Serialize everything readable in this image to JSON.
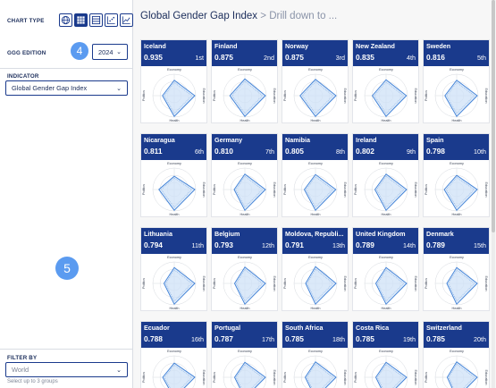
{
  "sidebar": {
    "chart_type_label": "CHART TYPE",
    "chart_type_options": [
      "globe-icon",
      "grid-icon",
      "list-icon",
      "scatter-icon",
      "line-icon"
    ],
    "edition_label": "GGG EDITION",
    "edition_badge": "4",
    "edition_value": "2024",
    "indicator_label": "INDICATOR",
    "indicator_value": "Global Gender Gap Index",
    "center_badge": "5",
    "filter_label": "FILTER BY",
    "filter_value": "World",
    "filter_hint": "Select up to 3 groups"
  },
  "main": {
    "title": "Global Gender Gap Index",
    "separator": ">",
    "drill_text": "Drill down to ...",
    "axis_labels": {
      "top": "Economy",
      "left": "Politics",
      "right": "Education",
      "bottom": "Health"
    },
    "cards": [
      {
        "name": "Iceland",
        "score": "0.935",
        "rank": "1st"
      },
      {
        "name": "Finland",
        "score": "0.875",
        "rank": "2nd"
      },
      {
        "name": "Norway",
        "score": "0.875",
        "rank": "3rd"
      },
      {
        "name": "New Zealand",
        "score": "0.835",
        "rank": "4th"
      },
      {
        "name": "Sweden",
        "score": "0.816",
        "rank": "5th"
      },
      {
        "name": "Nicaragua",
        "score": "0.811",
        "rank": "6th"
      },
      {
        "name": "Germany",
        "score": "0.810",
        "rank": "7th"
      },
      {
        "name": "Namibia",
        "score": "0.805",
        "rank": "8th"
      },
      {
        "name": "Ireland",
        "score": "0.802",
        "rank": "9th"
      },
      {
        "name": "Spain",
        "score": "0.798",
        "rank": "10th"
      },
      {
        "name": "Lithuania",
        "score": "0.794",
        "rank": "11th"
      },
      {
        "name": "Belgium",
        "score": "0.793",
        "rank": "12th"
      },
      {
        "name": "Moldova, Republi...",
        "score": "0.791",
        "rank": "13th"
      },
      {
        "name": "United Kingdom",
        "score": "0.789",
        "rank": "14th"
      },
      {
        "name": "Denmark",
        "score": "0.789",
        "rank": "15th"
      },
      {
        "name": "Ecuador",
        "score": "0.788",
        "rank": "16th"
      },
      {
        "name": "Portugal",
        "score": "0.787",
        "rank": "17th"
      },
      {
        "name": "South Africa",
        "score": "0.785",
        "rank": "18th"
      },
      {
        "name": "Costa Rica",
        "score": "0.785",
        "rank": "19th"
      },
      {
        "name": "Switzerland",
        "score": "0.785",
        "rank": "20th"
      }
    ]
  },
  "colors": {
    "accent": "#1a3a8c",
    "badge": "#5b9bf0",
    "radar_fill": "#cfe1f7",
    "radar_stroke": "#3d7fd6"
  }
}
